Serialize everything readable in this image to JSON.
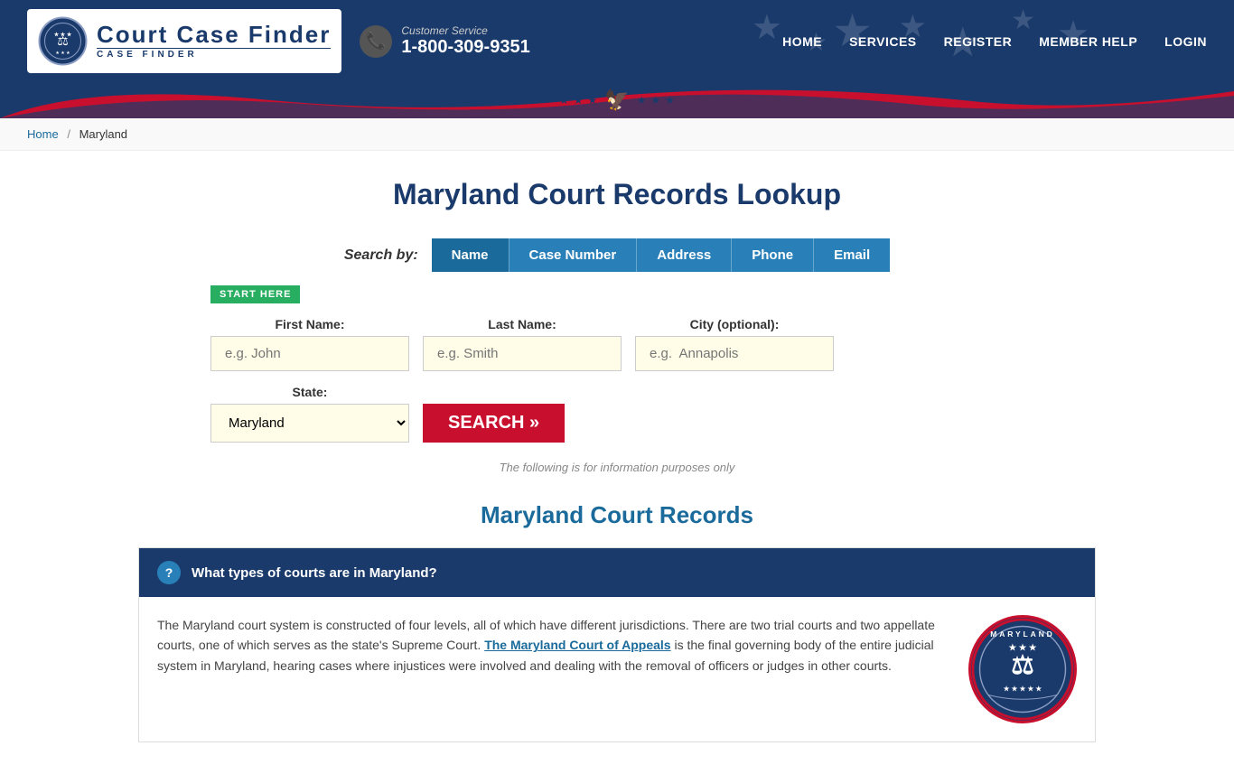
{
  "site": {
    "name": "Court Case Finder",
    "tagline": "CASE FINDER",
    "customer_service": {
      "label": "Customer Service",
      "phone": "1-800-309-9351"
    }
  },
  "nav": {
    "items": [
      {
        "label": "HOME",
        "href": "#"
      },
      {
        "label": "SERVICES",
        "href": "#"
      },
      {
        "label": "REGISTER",
        "href": "#"
      },
      {
        "label": "MEMBER HELP",
        "href": "#"
      },
      {
        "label": "LOGIN",
        "href": "#"
      }
    ]
  },
  "breadcrumb": {
    "home_label": "Home",
    "separator": "/",
    "current": "Maryland"
  },
  "page": {
    "title": "Maryland Court Records Lookup",
    "search_by_label": "Search by:",
    "search_tabs": [
      {
        "label": "Name",
        "active": true
      },
      {
        "label": "Case Number",
        "active": false
      },
      {
        "label": "Address",
        "active": false
      },
      {
        "label": "Phone",
        "active": false
      },
      {
        "label": "Email",
        "active": false
      }
    ],
    "start_here_badge": "START HERE",
    "form": {
      "first_name_label": "First Name:",
      "first_name_placeholder": "e.g. John",
      "last_name_label": "Last Name:",
      "last_name_placeholder": "e.g. Smith",
      "city_label": "City (optional):",
      "city_placeholder": "e.g.  Annapolis",
      "state_label": "State:",
      "state_value": "Maryland",
      "search_button": "SEARCH »"
    },
    "info_note": "The following is for information purposes only",
    "records_section_title": "Maryland Court Records",
    "faq": [
      {
        "question": "What types of courts are in Maryland?",
        "body": "The Maryland court system is constructed of four levels, all of which have different jurisdictions. There are two trial courts and two appellate courts, one of which serves as the state's Supreme Court. The Maryland Court of Appeals is the final governing body of the entire judicial system in Maryland, hearing cases where injustices were involved and dealing with the removal of officers or judges in other courts.",
        "link_text": "The Maryland Court of Appeals",
        "seal_label": "MARYLAND"
      }
    ]
  }
}
